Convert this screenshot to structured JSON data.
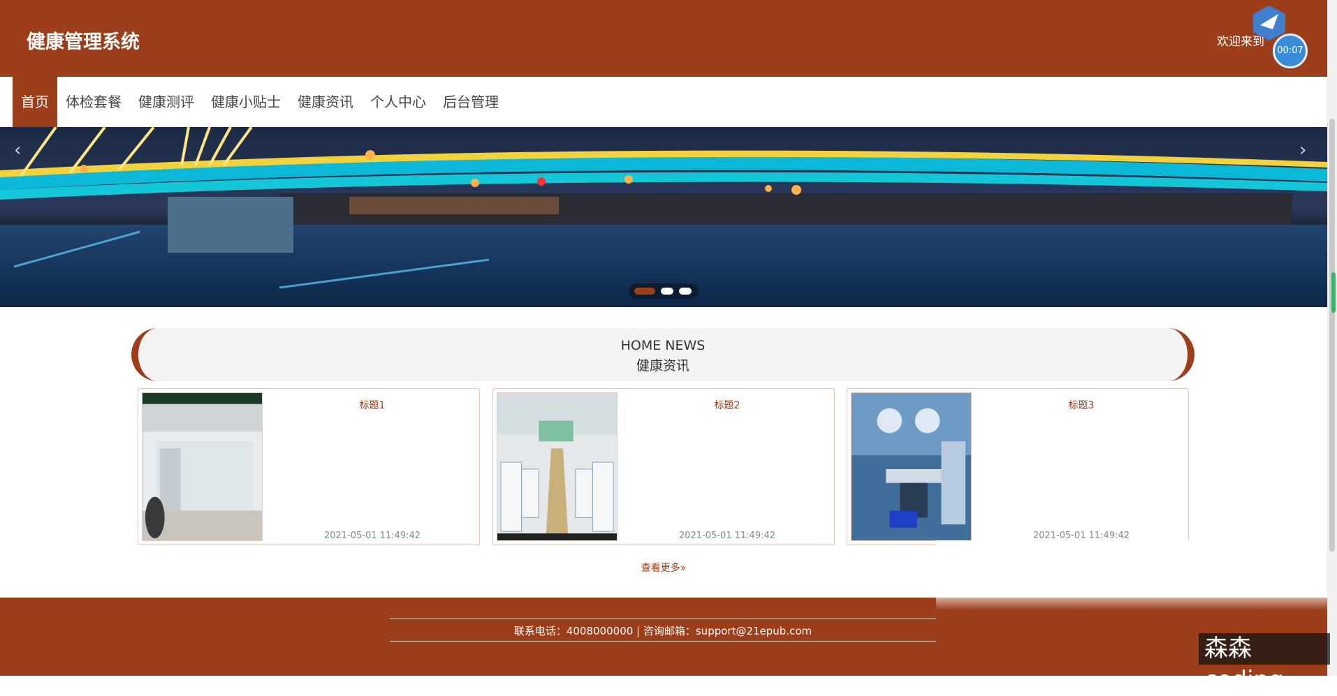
{
  "header": {
    "site_title": "健康管理系统",
    "welcome_text": "欢迎来到",
    "timer": "00:07"
  },
  "nav": {
    "items": [
      {
        "label": "首页",
        "active": true
      },
      {
        "label": "体检套餐"
      },
      {
        "label": "健康测评"
      },
      {
        "label": "健康小贴士"
      },
      {
        "label": "健康资讯"
      },
      {
        "label": "个人中心"
      },
      {
        "label": "后台管理"
      }
    ]
  },
  "banner": {
    "prev_icon": "chevron-left-icon",
    "next_icon": "chevron-right-icon",
    "slides": 3,
    "active_slide": 1
  },
  "news": {
    "heading_en": "HOME NEWS",
    "heading_zh": "健康资讯",
    "items": [
      {
        "title": "标题1",
        "date": "2021-05-01 11:49:42"
      },
      {
        "title": "标题2",
        "date": "2021-05-01 11:49:42"
      },
      {
        "title": "标题3",
        "date": "2021-05-01 11:49:42"
      }
    ],
    "view_more": "查看更多"
  },
  "footer": {
    "contact": "联系电话：4008000000 | 咨询邮箱：support@21epub.com"
  },
  "watermark": "森森coding",
  "colors": {
    "brand": "#9c3e1a",
    "timer": "#3a8bd9"
  }
}
